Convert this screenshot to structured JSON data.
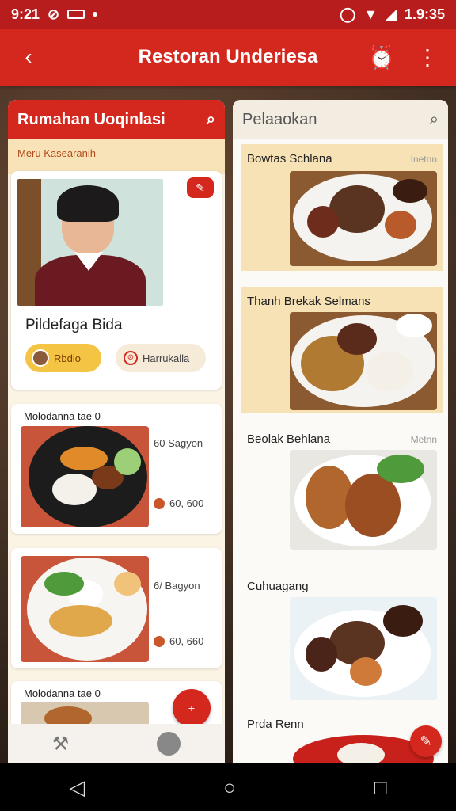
{
  "status": {
    "time": "9:21",
    "right_time": "1.9:35"
  },
  "appbar": {
    "title": "Restoran Underiesa",
    "back_icon": "back-arrow-icon",
    "action_icon": "alarm-icon",
    "more_icon": "more-vert-icon"
  },
  "left_panel": {
    "header": "Rumahan Uoqinlasi",
    "subheader": "Meru Kasearanih",
    "profile": {
      "name": "Pildefaga Bida",
      "pill_primary": "Rbdio",
      "pill_secondary": "Harrukalla"
    },
    "dishes": [
      {
        "title": "Molodanna tae 0",
        "tag": "60 Sagyon",
        "price": "60, 600"
      },
      {
        "title": "",
        "tag": "6/ Bagyon",
        "price": "60, 660"
      },
      {
        "title": "Molodanna tae 0",
        "tag": "",
        "price": ""
      }
    ],
    "fab_label": "+"
  },
  "right_panel": {
    "header": "Pelaaokan",
    "items": [
      {
        "title": "Bowtas Schlana",
        "meta": "Inetnn"
      },
      {
        "title": "Thanh Brekak Selmans",
        "meta": ""
      },
      {
        "title": "Beolak Behlana",
        "meta": "Metnn"
      },
      {
        "title": "Cuhuagang",
        "meta": ""
      },
      {
        "title": "Prda Renn",
        "meta": ""
      }
    ]
  },
  "colors": {
    "primary": "#d4271d",
    "accent": "#f4c445",
    "panel_bg": "#fbf3e4"
  }
}
